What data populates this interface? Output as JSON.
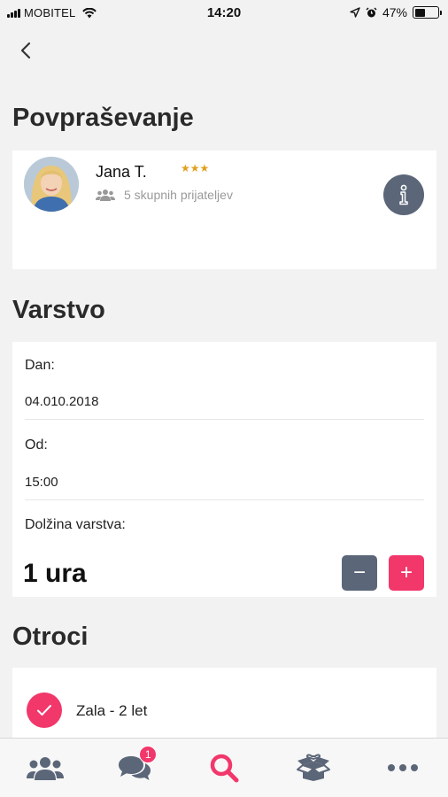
{
  "status_bar": {
    "carrier": "MOBITEL",
    "time": "14:20",
    "battery": "47%",
    "battery_level": 0.47,
    "icons": [
      "signal-icon",
      "wifi-icon",
      "location-arrow-icon",
      "alarm-icon",
      "battery-icon"
    ]
  },
  "nav": {
    "back_icon": "chevron-left-icon"
  },
  "request": {
    "title": "Povpraševanje",
    "user": {
      "name": "Jana T.",
      "stars": "★★★",
      "rating": 3,
      "mutual_friends": "5 skupnih prijateljev",
      "friends_icon": "users-icon"
    },
    "info_icon": "info-icon"
  },
  "shift": {
    "title": "Varstvo",
    "day_label": "Dan:",
    "day_value": "04.010.2018",
    "from_label": "Od:",
    "from_value": "15:00",
    "duration_label": "Dolžina varstva:",
    "duration_value": "1 ura",
    "minus": "−",
    "plus": "+"
  },
  "children": {
    "title": "Otroci",
    "items": [
      {
        "label": "Zala - 2 let",
        "checked": true
      }
    ]
  },
  "tab_bar": {
    "items": [
      {
        "icon": "users-icon"
      },
      {
        "icon": "chat-icon",
        "badge": "1"
      },
      {
        "icon": "search-icon",
        "active": true
      },
      {
        "icon": "box-icon"
      },
      {
        "icon": "more-icon"
      }
    ]
  },
  "colors": {
    "accent": "#f2376b",
    "dark": "#5b6678",
    "star": "#e0a020",
    "inactive_tab": "#5b6678"
  }
}
